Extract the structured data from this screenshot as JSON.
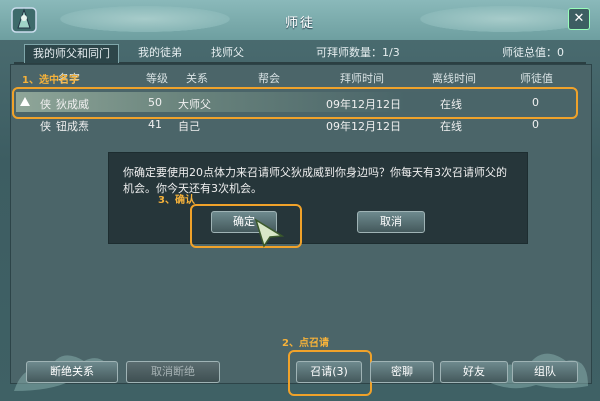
{
  "window": {
    "title": "师徒",
    "close_glyph": "✕"
  },
  "tabs": [
    {
      "label": "我的师父和同门",
      "active": true
    },
    {
      "label": "我的徒弟",
      "active": false
    },
    {
      "label": "找师父",
      "active": false
    }
  ],
  "status": {
    "recruitable_label": "可拜师数量：1/3",
    "total_label": "师徒总值：0"
  },
  "table": {
    "headers": [
      "名字",
      "等级",
      "关系",
      "帮会",
      "拜师时间",
      "离线时间",
      "师徒值"
    ],
    "rows": [
      {
        "icon": "侠",
        "name": "狄成威",
        "level": "50",
        "relation": "大师父",
        "guild": "",
        "join": "09年12月12日",
        "status": "在线",
        "value": "0",
        "selected": true
      },
      {
        "icon": "侠",
        "name": "钮成焘",
        "level": "41",
        "relation": "自己",
        "guild": "",
        "join": "09年12月12日",
        "status": "在线",
        "value": "0",
        "selected": false
      }
    ]
  },
  "dialog": {
    "message": "你确定要使用20点体力来召请师父狄成威到你身边吗？你每天有3次召请师父的机会。你今天还有3次机会。",
    "confirm": "确定",
    "cancel": "取消"
  },
  "annotations": {
    "step1": "1、选中名字",
    "step2": "2、点召请",
    "step3": "3、确认"
  },
  "bottom_buttons": {
    "break": "断绝关系",
    "cancel_break": "取消断绝",
    "summon": "召请(3)",
    "chat": "密聊",
    "friend": "好友",
    "team": "组队"
  },
  "colors": {
    "annotation": "#f0a22a",
    "window_bg": "#4d6f73",
    "title_bg": "#8ab9ba"
  }
}
